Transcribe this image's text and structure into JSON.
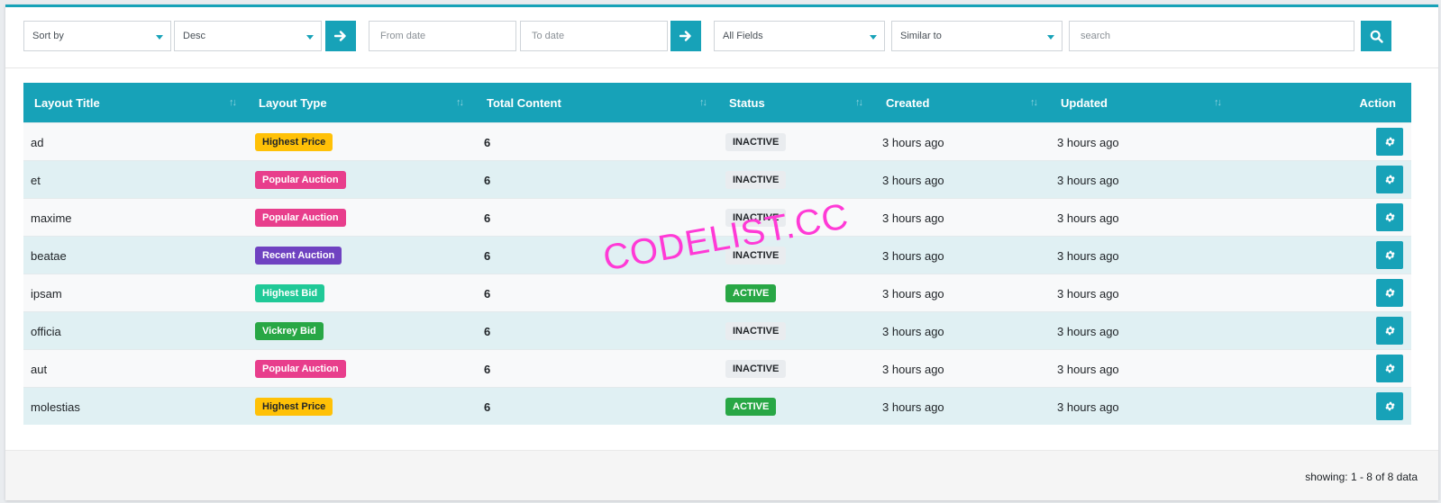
{
  "filters": {
    "sort_by": "Sort by",
    "order": "Desc",
    "from_date_placeholder": "From date",
    "to_date_placeholder": "To date",
    "field": "All Fields",
    "match": "Similar to",
    "search_placeholder": "search"
  },
  "table": {
    "headers": [
      "Layout Title",
      "Layout Type",
      "Total Content",
      "Status",
      "Created",
      "Updated",
      "Action"
    ],
    "rows": [
      {
        "title": "ad",
        "type": "Highest Price",
        "type_color": "#ffc107",
        "type_text": "#212529",
        "total": "6",
        "status": "INACTIVE",
        "created": "3 hours ago",
        "updated": "3 hours ago"
      },
      {
        "title": "et",
        "type": "Popular Auction",
        "type_color": "#e83e8c",
        "type_text": "#ffffff",
        "total": "6",
        "status": "INACTIVE",
        "created": "3 hours ago",
        "updated": "3 hours ago"
      },
      {
        "title": "maxime",
        "type": "Popular Auction",
        "type_color": "#e83e8c",
        "type_text": "#ffffff",
        "total": "6",
        "status": "INACTIVE",
        "created": "3 hours ago",
        "updated": "3 hours ago"
      },
      {
        "title": "beatae",
        "type": "Recent Auction",
        "type_color": "#6f42c1",
        "type_text": "#ffffff",
        "total": "6",
        "status": "INACTIVE",
        "created": "3 hours ago",
        "updated": "3 hours ago"
      },
      {
        "title": "ipsam",
        "type": "Highest Bid",
        "type_color": "#20c997",
        "type_text": "#ffffff",
        "total": "6",
        "status": "ACTIVE",
        "created": "3 hours ago",
        "updated": "3 hours ago"
      },
      {
        "title": "officia",
        "type": "Vickrey Bid",
        "type_color": "#28a745",
        "type_text": "#ffffff",
        "total": "6",
        "status": "INACTIVE",
        "created": "3 hours ago",
        "updated": "3 hours ago"
      },
      {
        "title": "aut",
        "type": "Popular Auction",
        "type_color": "#e83e8c",
        "type_text": "#ffffff",
        "total": "6",
        "status": "INACTIVE",
        "created": "3 hours ago",
        "updated": "3 hours ago"
      },
      {
        "title": "molestias",
        "type": "Highest Price",
        "type_color": "#ffc107",
        "type_text": "#212529",
        "total": "6",
        "status": "ACTIVE",
        "created": "3 hours ago",
        "updated": "3 hours ago"
      }
    ]
  },
  "footer": {
    "showing": "showing: 1 - 8 of 8 data"
  },
  "watermark": "CODELIST.CC",
  "colors": {
    "accent": "#17a2b8",
    "active": "#28a745",
    "inactive_bg": "#e9ecef"
  },
  "icons": {
    "apply": "arrow-right-icon",
    "search": "search-icon",
    "action": "gear-icon",
    "sort": "sort-arrows-icon",
    "dropdown": "caret-down-icon"
  }
}
